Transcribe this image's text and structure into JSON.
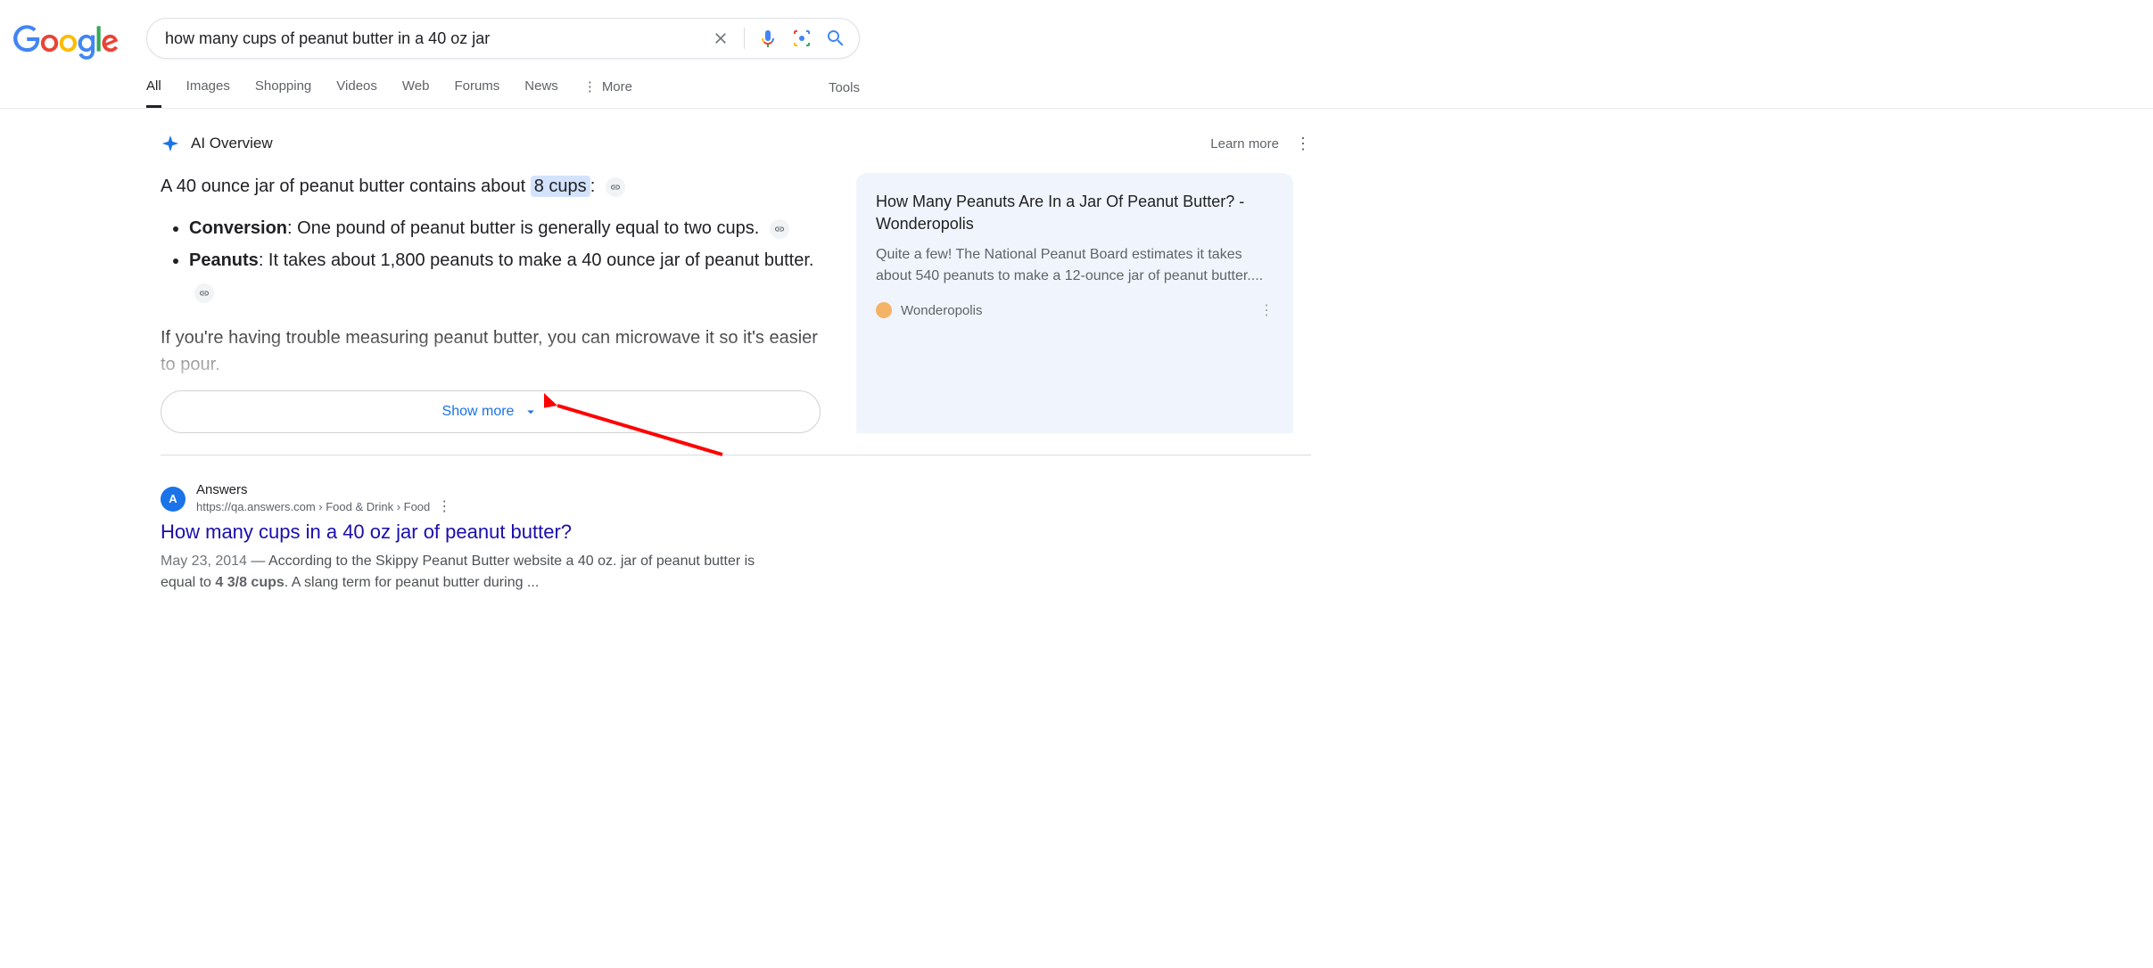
{
  "search": {
    "query": "how many cups of peanut butter in a 40 oz jar"
  },
  "tabs": {
    "items": [
      "All",
      "Images",
      "Shopping",
      "Videos",
      "Web",
      "Forums",
      "News"
    ],
    "more": "More",
    "tools": "Tools"
  },
  "ai": {
    "title": "AI Overview",
    "learn_more": "Learn more",
    "intro_pre": "A 40 ounce jar of peanut butter contains about ",
    "intro_highlight": "8 cups",
    "intro_post": ":",
    "bullets": [
      {
        "label": "Conversion",
        "text": ": One pound of peanut butter is generally equal to two cups."
      },
      {
        "label": "Peanuts",
        "text": ": It takes about 1,800 peanuts to make a 40 ounce jar of peanut butter."
      }
    ],
    "fade_text": "If you're having trouble measuring peanut butter, you can microwave it so it's easier to pour.",
    "show_more": "Show more",
    "card": {
      "title": "How Many Peanuts Are In a Jar Of Peanut Butter? - Wonderopolis",
      "desc": "Quite a few! The National Peanut Board estimates it takes about 540 peanuts to make a 12-ounce jar of peanut butter....",
      "source": "Wonderopolis"
    }
  },
  "result": {
    "source": "Answers",
    "url": "https://qa.answers.com › Food & Drink › Food",
    "title": "How many cups in a 40 oz jar of peanut butter?",
    "date": "May 23, 2014",
    "snippet_pre": " — According to the Skippy Peanut Butter website a 40 oz. jar of peanut butter is equal to ",
    "snippet_bold": "4 3/8 cups",
    "snippet_post": ". A slang term for peanut butter during ..."
  }
}
